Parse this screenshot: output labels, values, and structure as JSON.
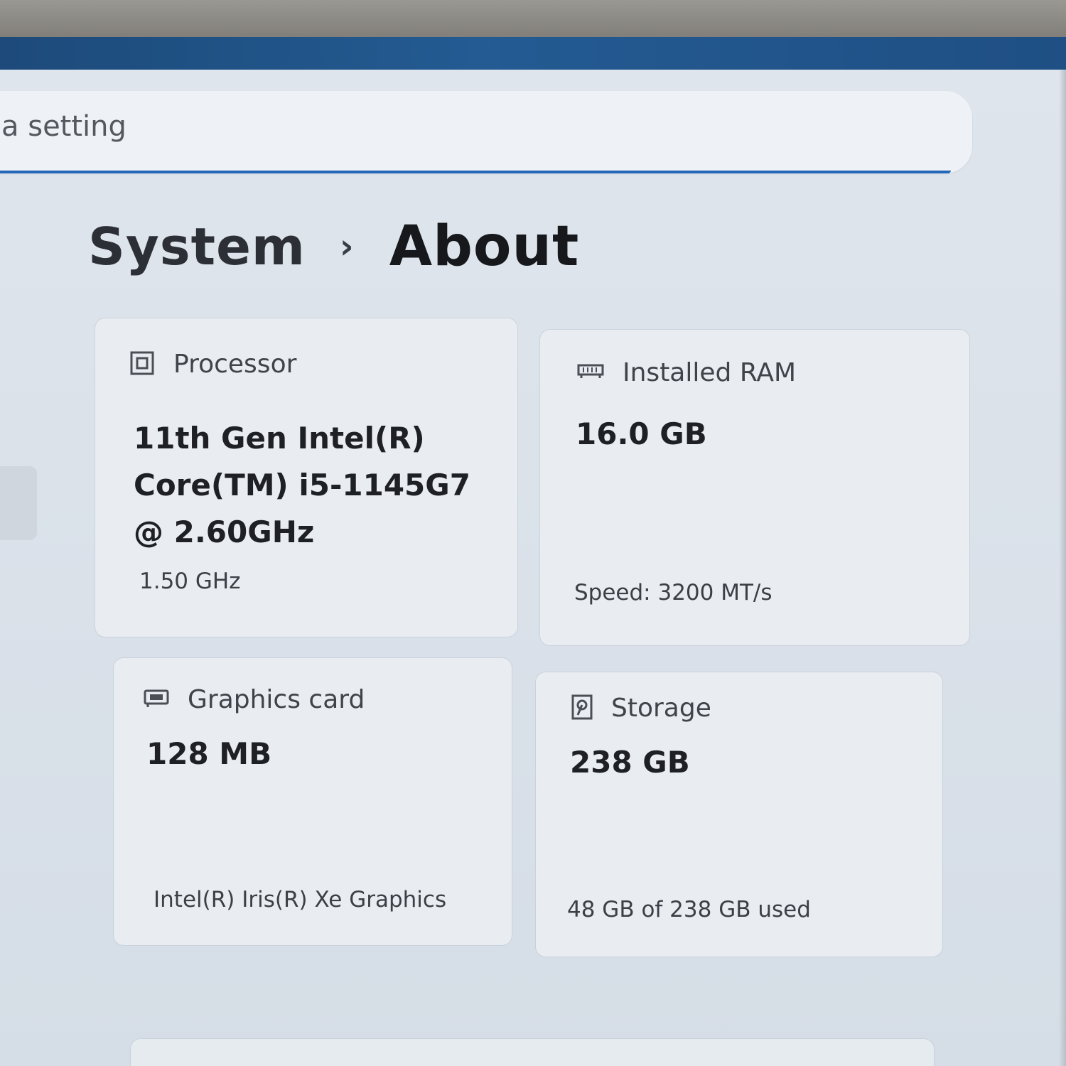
{
  "search": {
    "placeholder": "a setting"
  },
  "breadcrumb": {
    "parent": "System",
    "separator": "›",
    "current": "About"
  },
  "specs": {
    "processor": {
      "label": "Processor",
      "icon": "processor-icon",
      "value": "11th Gen Intel(R) Core(TM) i5-1145G7 @ 2.60GHz",
      "detail": "1.50 GHz"
    },
    "ram": {
      "label": "Installed RAM",
      "icon": "ram-icon",
      "value": "16.0 GB",
      "detail": "Speed: 3200 MT/s"
    },
    "graphics": {
      "label": "Graphics card",
      "icon": "graphics-card-icon",
      "value": "128 MB",
      "detail": "Intel(R) Iris(R) Xe Graphics"
    },
    "storage": {
      "label": "Storage",
      "icon": "storage-icon",
      "value": "238 GB",
      "detail": "48 GB of 238 GB used"
    }
  },
  "colors": {
    "accent": "#2367b8",
    "title_strip": "#235b92",
    "screen_bg": "#dbe2ea",
    "card_bg": "#e9edf2"
  }
}
